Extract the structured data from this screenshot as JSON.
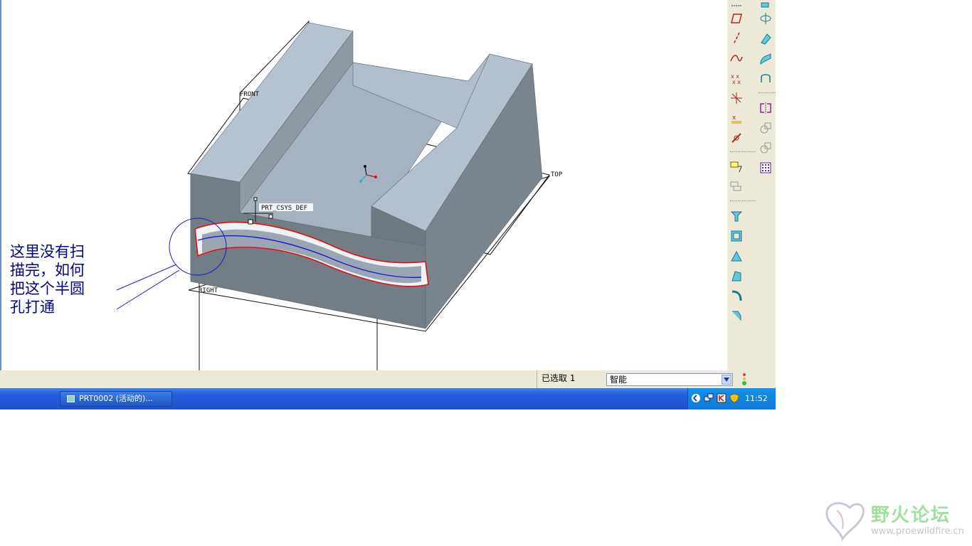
{
  "viewport": {
    "datum_labels": {
      "front": "FRONT",
      "top": "TOP",
      "right": "RIGHT",
      "csys": "PRT_CSYS_DEF"
    }
  },
  "annotation": {
    "lines": [
      "这里没有扫",
      "描完，如何",
      "把这个半圆",
      "孔打通"
    ]
  },
  "toolbar": {
    "icons": [
      "datum-plane-icon",
      "datum-plane-icon",
      "datum-axis-icon",
      "datum-curve-icon",
      "datum-point-icon",
      "offset-point-icon",
      "field-point-icon",
      "csys-icon",
      "analysis-icon",
      "sketched-datum-icon",
      "hole-icon",
      "shell-icon",
      "rib-icon",
      "draft-icon",
      "round-icon",
      "chamfer-icon",
      "extrude-icon",
      "revolve-icon",
      "sweep-icon",
      "blend-icon",
      "boundary-blend-icon",
      "mirror-icon",
      "merge-icon",
      "intersect-icon",
      "pattern-icon"
    ]
  },
  "statusbar": {
    "selected_text": "已选取 1",
    "filter_value": "智能"
  },
  "taskbar": {
    "window_button": "PRT0002 (活动的)...",
    "clock": "11:52"
  },
  "watermark": {
    "title": "野火论坛",
    "url": "www.proewildfire.cn"
  },
  "colors": {
    "edge_highlight": "#e01010",
    "sweep_trajectory": "#1a1ad0",
    "annotation_text": "#00008b",
    "model_top": "#a9b8c6",
    "model_front": "#768089"
  }
}
